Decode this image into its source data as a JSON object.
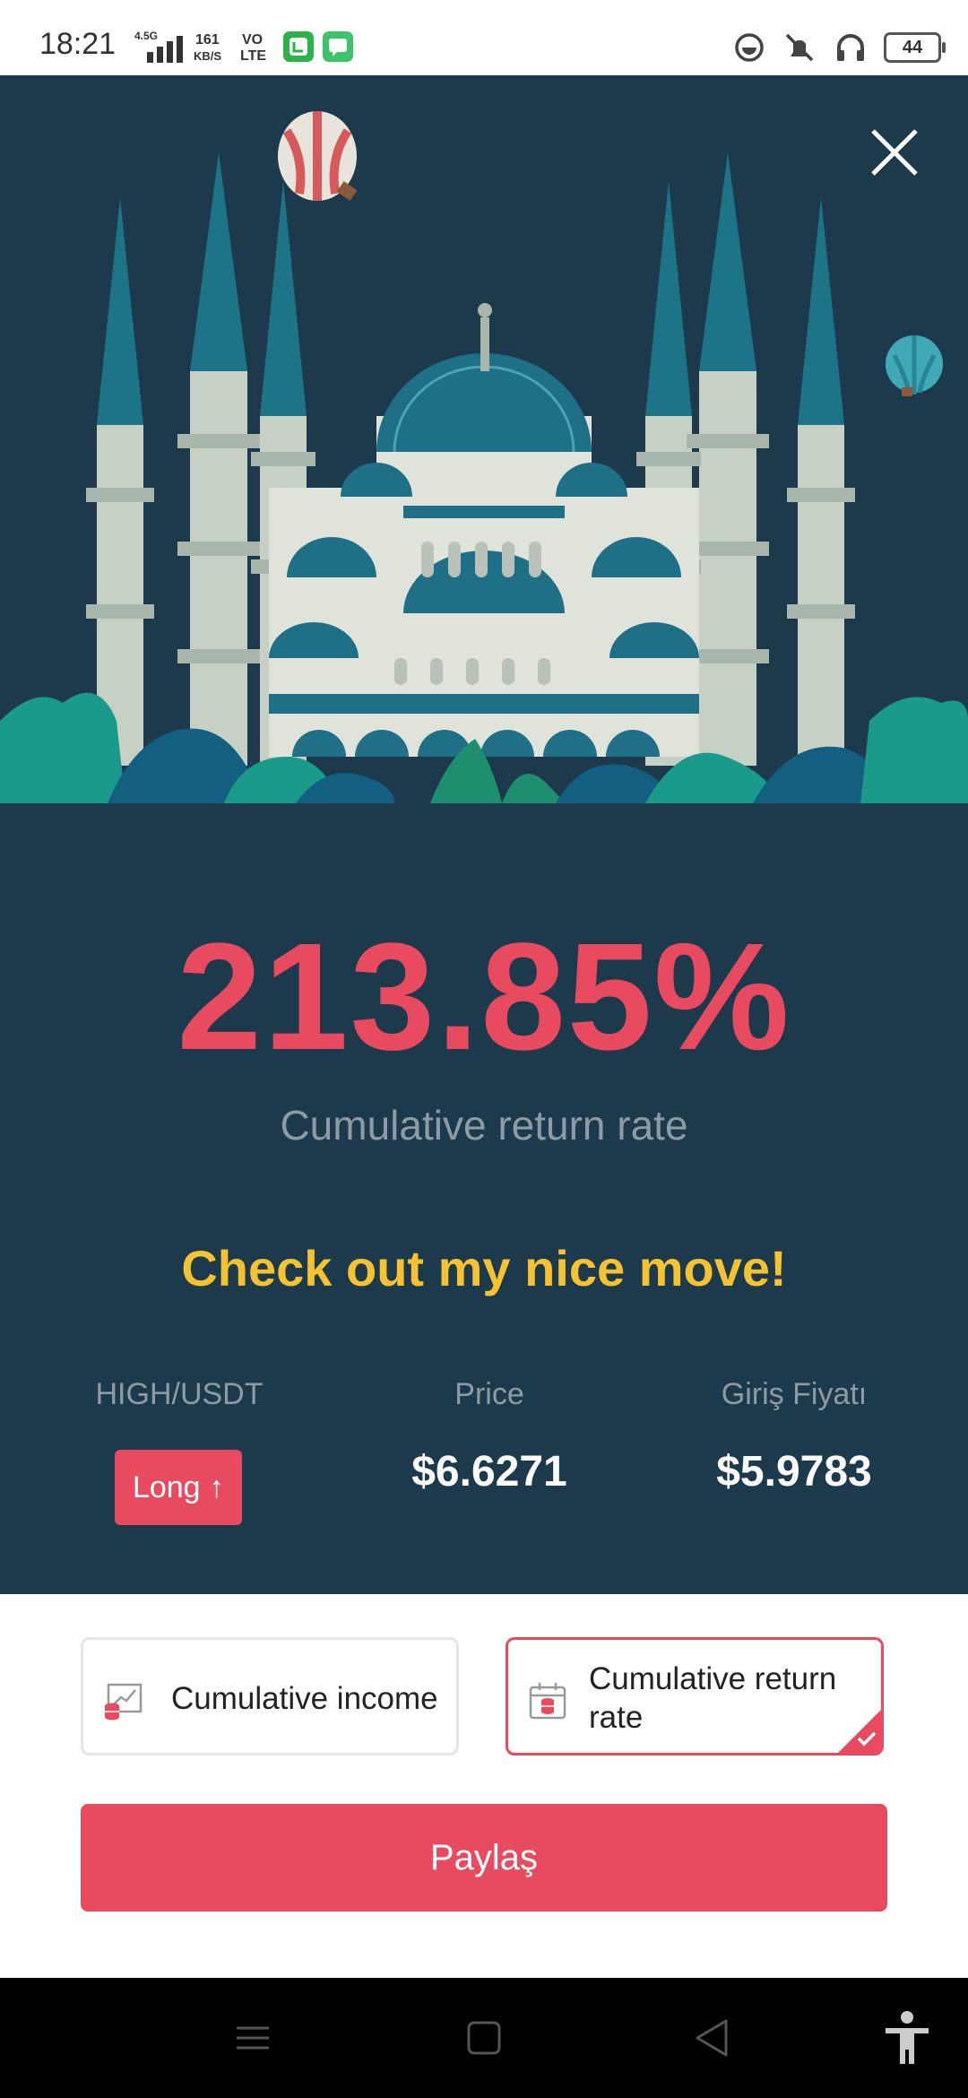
{
  "status_bar": {
    "time": "18:21",
    "network_type": "4.5G",
    "speed_value": "161",
    "speed_unit": "KB/S",
    "volte_top": "VO",
    "volte_bottom": "LTE",
    "battery": "44"
  },
  "card": {
    "return_value": "213.85%",
    "return_label": "Cumulative return rate",
    "slogan": "Check out my nice move!",
    "pair_header": "HIGH/USDT",
    "direction_badge": "Long ↑",
    "price_header": "Price",
    "price_value": "$6.6271",
    "entry_header": "Giriş Fiyatı",
    "entry_value": "$5.9783"
  },
  "options": {
    "income_label": "Cumulative income",
    "return_label_line1": "Cumulative return",
    "return_label_line2": "rate",
    "selected": "Cumulative return rate"
  },
  "share_button": "Paylaş",
  "colors": {
    "card_bg": "#1c3a4c",
    "accent_red": "#e84a5f",
    "slogan_yellow": "#f5c331",
    "muted_text": "#8c9ca7"
  },
  "icons": {
    "close": "close-icon",
    "income": "income-chart-icon",
    "calendar": "calendar-icon",
    "nav_menu": "menu-icon",
    "nav_home": "home-icon",
    "nav_back": "back-icon",
    "accessibility": "accessibility-icon"
  }
}
